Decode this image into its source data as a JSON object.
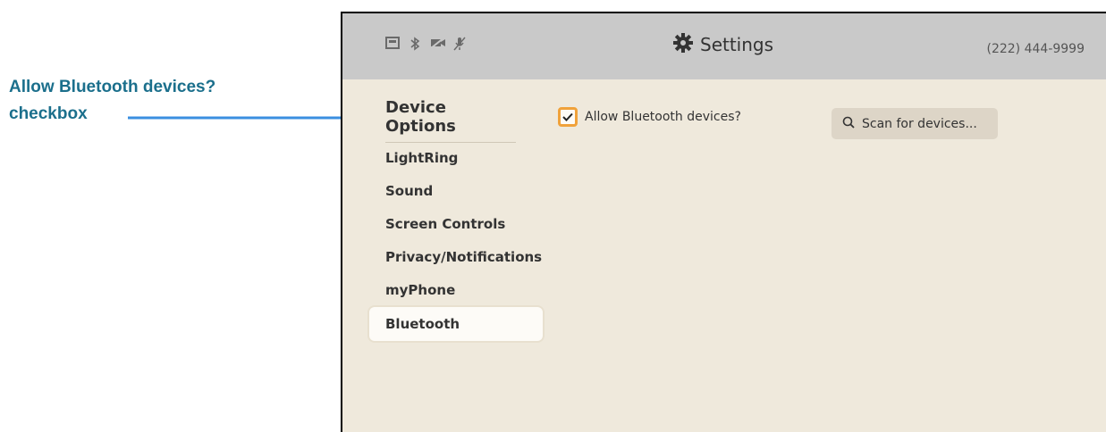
{
  "callout": {
    "line1": "Allow Bluetooth devices?",
    "line2": "checkbox",
    "color": "#1b6f8c",
    "arrow_color": "#3b8fe0"
  },
  "header": {
    "status_icons": [
      "tty-icon",
      "bluetooth-icon",
      "video-off-icon",
      "mic-off-icon"
    ],
    "title": "Settings",
    "title_icon": "gear-icon",
    "phone_number": "(222) 444-9999"
  },
  "sidebar": {
    "heading": "Device Options",
    "items": [
      {
        "label": "LightRing",
        "active": false
      },
      {
        "label": "Sound",
        "active": false
      },
      {
        "label": "Screen Controls",
        "active": false
      },
      {
        "label": "Privacy/Notifications",
        "active": false
      },
      {
        "label": "myPhone",
        "active": false
      },
      {
        "label": "Bluetooth",
        "active": true
      }
    ]
  },
  "bluetooth": {
    "allow_label": "Allow Bluetooth devices?",
    "allow_checked": true,
    "scan_label": "Scan for devices...",
    "scan_icon": "search-icon"
  },
  "colors": {
    "background": "#efe9dc",
    "header_bar": "#c9c9c9",
    "checkbox_border": "#f0a23b"
  }
}
